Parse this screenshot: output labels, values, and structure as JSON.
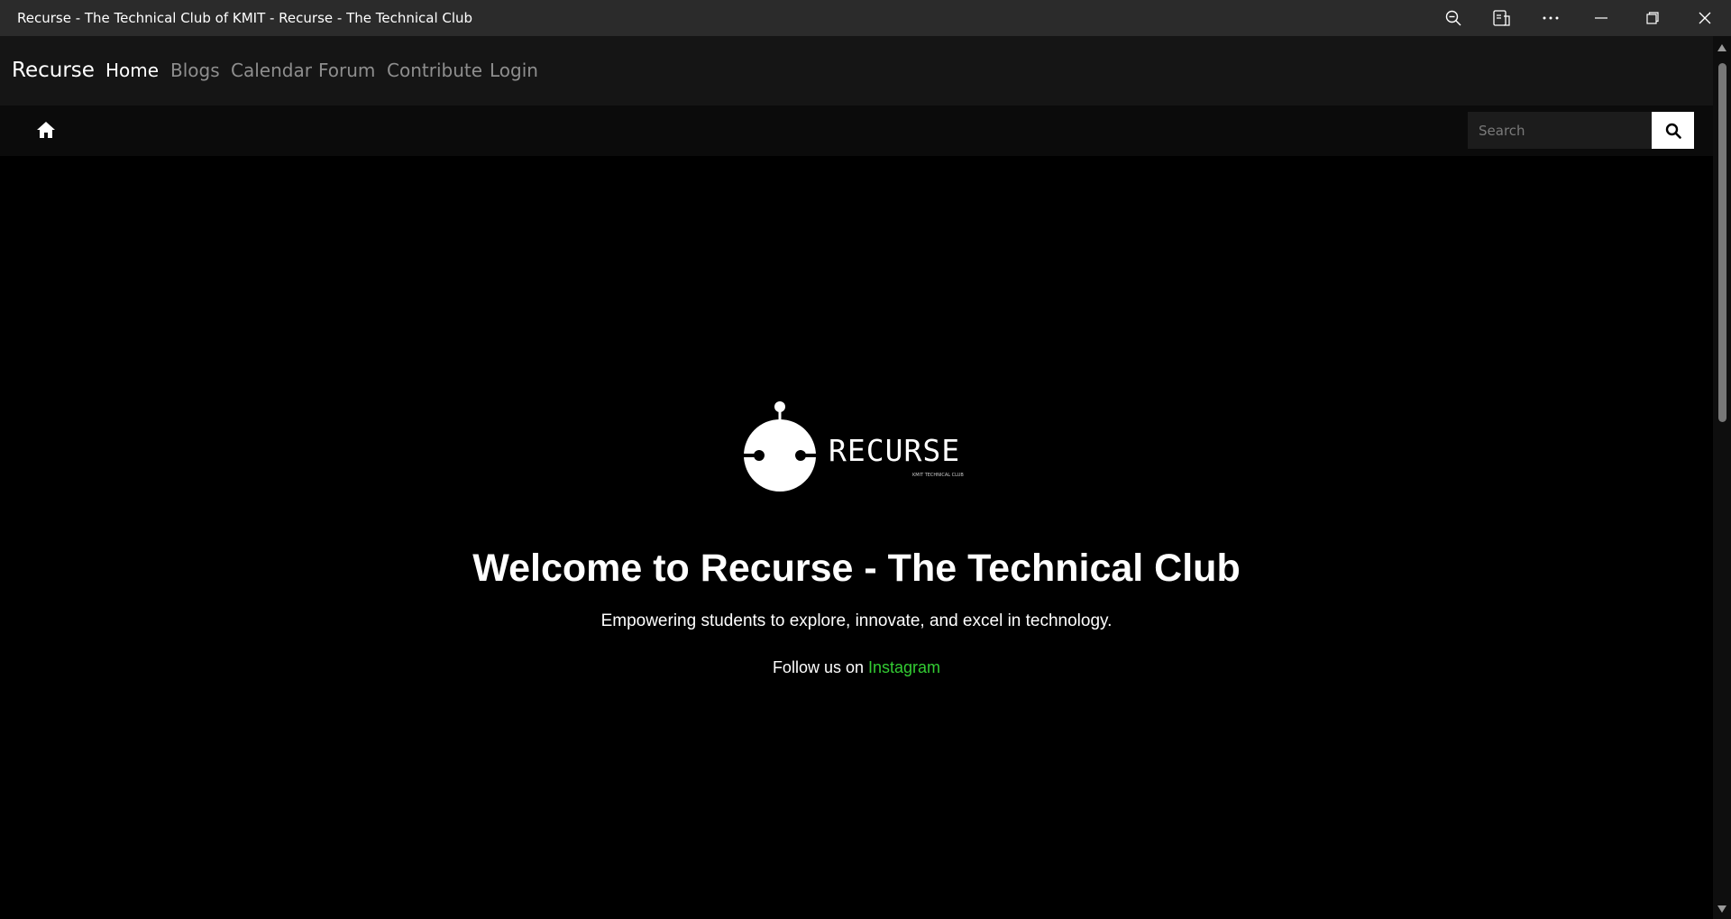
{
  "window": {
    "title": "Recurse - The Technical Club of KMIT - Recurse - The Technical Club",
    "controls": [
      "zoom-out-icon",
      "reader-view-icon",
      "more-icon",
      "minimize-icon",
      "restore-icon",
      "close-icon"
    ]
  },
  "navbar": {
    "brand": "Recurse",
    "items": [
      {
        "label": "Home",
        "active": true
      },
      {
        "label": "Blogs",
        "active": false
      },
      {
        "label": "Calendar",
        "active": false
      },
      {
        "label": "Forum",
        "active": false
      },
      {
        "label": "Contribute",
        "active": false
      },
      {
        "label": "Login",
        "active": false
      }
    ]
  },
  "subbar": {
    "home_icon": "home-icon",
    "search": {
      "placeholder": "Search",
      "value": "",
      "button_icon": "search-icon"
    }
  },
  "hero": {
    "logo_word": "RECURSE",
    "logo_sub": "KMIT TECHNICAL CLUB",
    "title": "Welcome to Recurse - The Technical Club",
    "subtitle": "Empowering students to explore, innovate, and excel in technology.",
    "follow_text": "Follow us on",
    "follow_link": "Instagram"
  },
  "colors": {
    "background": "#000000",
    "navbar": "#151515",
    "link_accent": "#33cc33",
    "nav_inactive": "#8e8e8e"
  }
}
